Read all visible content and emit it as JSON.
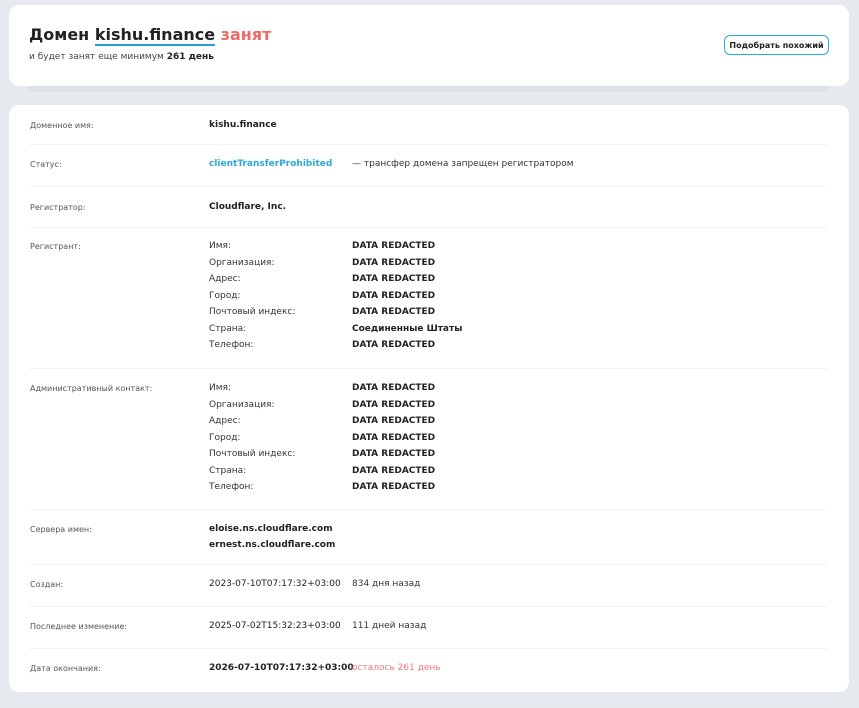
{
  "header": {
    "title_prefix": "Домен",
    "domain": "kishu.finance",
    "status_word": "занят",
    "subtitle_prefix": "и будет занят еще минимум",
    "subtitle_days": "261 день",
    "suggest_button": "Подобрать похожий"
  },
  "colors": {
    "accent": "#2aa8dc",
    "busy": "#f06a6a"
  },
  "details": {
    "domain_name": {
      "label": "Доменное имя:",
      "value": "kishu.finance"
    },
    "status": {
      "label": "Статус:",
      "value": "clientTransferProhibited",
      "note": "— трансфер домена запрещен регистратором"
    },
    "registrar": {
      "label": "Регистратор:",
      "value": "Cloudflare, Inc."
    },
    "registrant": {
      "label": "Регистрант:",
      "fields": [
        {
          "k": "Имя:",
          "v": "DATA REDACTED"
        },
        {
          "k": "Организация:",
          "v": "DATA REDACTED"
        },
        {
          "k": "Адрес:",
          "v": "DATA REDACTED"
        },
        {
          "k": "Город:",
          "v": "DATA REDACTED"
        },
        {
          "k": "Почтовый индекс:",
          "v": "DATA REDACTED"
        },
        {
          "k": "Страна:",
          "v": "Соединенные Штаты"
        },
        {
          "k": "Телефон:",
          "v": "DATA REDACTED"
        }
      ]
    },
    "admin": {
      "label": "Административный контакт:",
      "fields": [
        {
          "k": "Имя:",
          "v": "DATA REDACTED"
        },
        {
          "k": "Организация:",
          "v": "DATA REDACTED"
        },
        {
          "k": "Адрес:",
          "v": "DATA REDACTED"
        },
        {
          "k": "Город:",
          "v": "DATA REDACTED"
        },
        {
          "k": "Почтовый индекс:",
          "v": "DATA REDACTED"
        },
        {
          "k": "Страна:",
          "v": "DATA REDACTED"
        },
        {
          "k": "Телефон:",
          "v": "DATA REDACTED"
        }
      ]
    },
    "nameservers": {
      "label": "Сервера имен:",
      "values": [
        "eloise.ns.cloudflare.com",
        "ernest.ns.cloudflare.com"
      ]
    },
    "created": {
      "label": "Создан:",
      "value": "2023-07-10T07:17:32+03:00",
      "ago": "834 дня назад"
    },
    "updated": {
      "label": "Последнее изменение:",
      "value": "2025-07-02T15:32:23+03:00",
      "ago": "111 дней назад"
    },
    "expires": {
      "label": "Дата окончания:",
      "value": "2026-07-10T07:17:32+03:00",
      "left": "осталось 261 день"
    }
  }
}
